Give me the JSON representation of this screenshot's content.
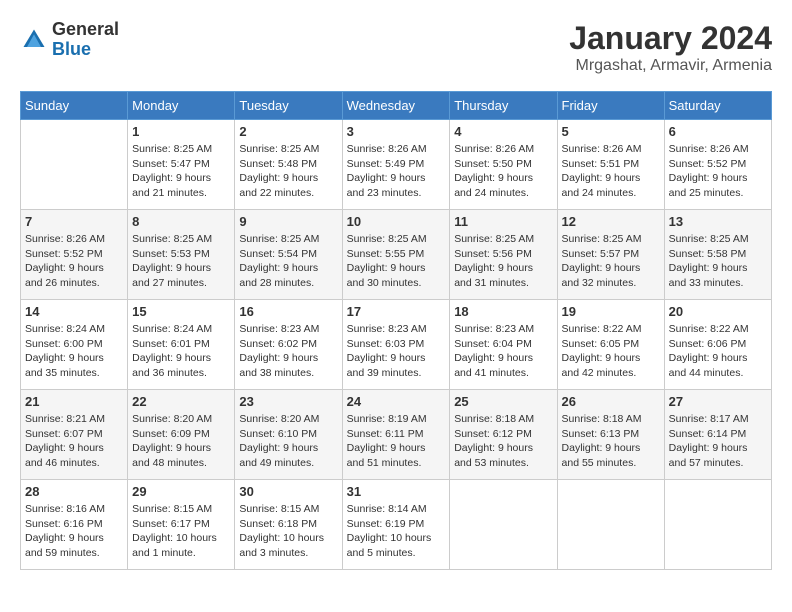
{
  "logo": {
    "general": "General",
    "blue": "Blue"
  },
  "header": {
    "month_year": "January 2024",
    "location": "Mrgashat, Armavir, Armenia"
  },
  "days_of_week": [
    "Sunday",
    "Monday",
    "Tuesday",
    "Wednesday",
    "Thursday",
    "Friday",
    "Saturday"
  ],
  "weeks": [
    [
      {
        "day": null,
        "info": null
      },
      {
        "day": "1",
        "sunrise": "8:25 AM",
        "sunset": "5:47 PM",
        "daylight": "9 hours and 21 minutes."
      },
      {
        "day": "2",
        "sunrise": "8:25 AM",
        "sunset": "5:48 PM",
        "daylight": "9 hours and 22 minutes."
      },
      {
        "day": "3",
        "sunrise": "8:26 AM",
        "sunset": "5:49 PM",
        "daylight": "9 hours and 23 minutes."
      },
      {
        "day": "4",
        "sunrise": "8:26 AM",
        "sunset": "5:50 PM",
        "daylight": "9 hours and 24 minutes."
      },
      {
        "day": "5",
        "sunrise": "8:26 AM",
        "sunset": "5:51 PM",
        "daylight": "9 hours and 24 minutes."
      },
      {
        "day": "6",
        "sunrise": "8:26 AM",
        "sunset": "5:52 PM",
        "daylight": "9 hours and 25 minutes."
      }
    ],
    [
      {
        "day": "7",
        "sunrise": "8:26 AM",
        "sunset": "5:52 PM",
        "daylight": "9 hours and 26 minutes."
      },
      {
        "day": "8",
        "sunrise": "8:25 AM",
        "sunset": "5:53 PM",
        "daylight": "9 hours and 27 minutes."
      },
      {
        "day": "9",
        "sunrise": "8:25 AM",
        "sunset": "5:54 PM",
        "daylight": "9 hours and 28 minutes."
      },
      {
        "day": "10",
        "sunrise": "8:25 AM",
        "sunset": "5:55 PM",
        "daylight": "9 hours and 30 minutes."
      },
      {
        "day": "11",
        "sunrise": "8:25 AM",
        "sunset": "5:56 PM",
        "daylight": "9 hours and 31 minutes."
      },
      {
        "day": "12",
        "sunrise": "8:25 AM",
        "sunset": "5:57 PM",
        "daylight": "9 hours and 32 minutes."
      },
      {
        "day": "13",
        "sunrise": "8:25 AM",
        "sunset": "5:58 PM",
        "daylight": "9 hours and 33 minutes."
      }
    ],
    [
      {
        "day": "14",
        "sunrise": "8:24 AM",
        "sunset": "6:00 PM",
        "daylight": "9 hours and 35 minutes."
      },
      {
        "day": "15",
        "sunrise": "8:24 AM",
        "sunset": "6:01 PM",
        "daylight": "9 hours and 36 minutes."
      },
      {
        "day": "16",
        "sunrise": "8:23 AM",
        "sunset": "6:02 PM",
        "daylight": "9 hours and 38 minutes."
      },
      {
        "day": "17",
        "sunrise": "8:23 AM",
        "sunset": "6:03 PM",
        "daylight": "9 hours and 39 minutes."
      },
      {
        "day": "18",
        "sunrise": "8:23 AM",
        "sunset": "6:04 PM",
        "daylight": "9 hours and 41 minutes."
      },
      {
        "day": "19",
        "sunrise": "8:22 AM",
        "sunset": "6:05 PM",
        "daylight": "9 hours and 42 minutes."
      },
      {
        "day": "20",
        "sunrise": "8:22 AM",
        "sunset": "6:06 PM",
        "daylight": "9 hours and 44 minutes."
      }
    ],
    [
      {
        "day": "21",
        "sunrise": "8:21 AM",
        "sunset": "6:07 PM",
        "daylight": "9 hours and 46 minutes."
      },
      {
        "day": "22",
        "sunrise": "8:20 AM",
        "sunset": "6:09 PM",
        "daylight": "9 hours and 48 minutes."
      },
      {
        "day": "23",
        "sunrise": "8:20 AM",
        "sunset": "6:10 PM",
        "daylight": "9 hours and 49 minutes."
      },
      {
        "day": "24",
        "sunrise": "8:19 AM",
        "sunset": "6:11 PM",
        "daylight": "9 hours and 51 minutes."
      },
      {
        "day": "25",
        "sunrise": "8:18 AM",
        "sunset": "6:12 PM",
        "daylight": "9 hours and 53 minutes."
      },
      {
        "day": "26",
        "sunrise": "8:18 AM",
        "sunset": "6:13 PM",
        "daylight": "9 hours and 55 minutes."
      },
      {
        "day": "27",
        "sunrise": "8:17 AM",
        "sunset": "6:14 PM",
        "daylight": "9 hours and 57 minutes."
      }
    ],
    [
      {
        "day": "28",
        "sunrise": "8:16 AM",
        "sunset": "6:16 PM",
        "daylight": "9 hours and 59 minutes."
      },
      {
        "day": "29",
        "sunrise": "8:15 AM",
        "sunset": "6:17 PM",
        "daylight": "10 hours and 1 minute."
      },
      {
        "day": "30",
        "sunrise": "8:15 AM",
        "sunset": "6:18 PM",
        "daylight": "10 hours and 3 minutes."
      },
      {
        "day": "31",
        "sunrise": "8:14 AM",
        "sunset": "6:19 PM",
        "daylight": "10 hours and 5 minutes."
      },
      {
        "day": null,
        "info": null
      },
      {
        "day": null,
        "info": null
      },
      {
        "day": null,
        "info": null
      }
    ]
  ]
}
